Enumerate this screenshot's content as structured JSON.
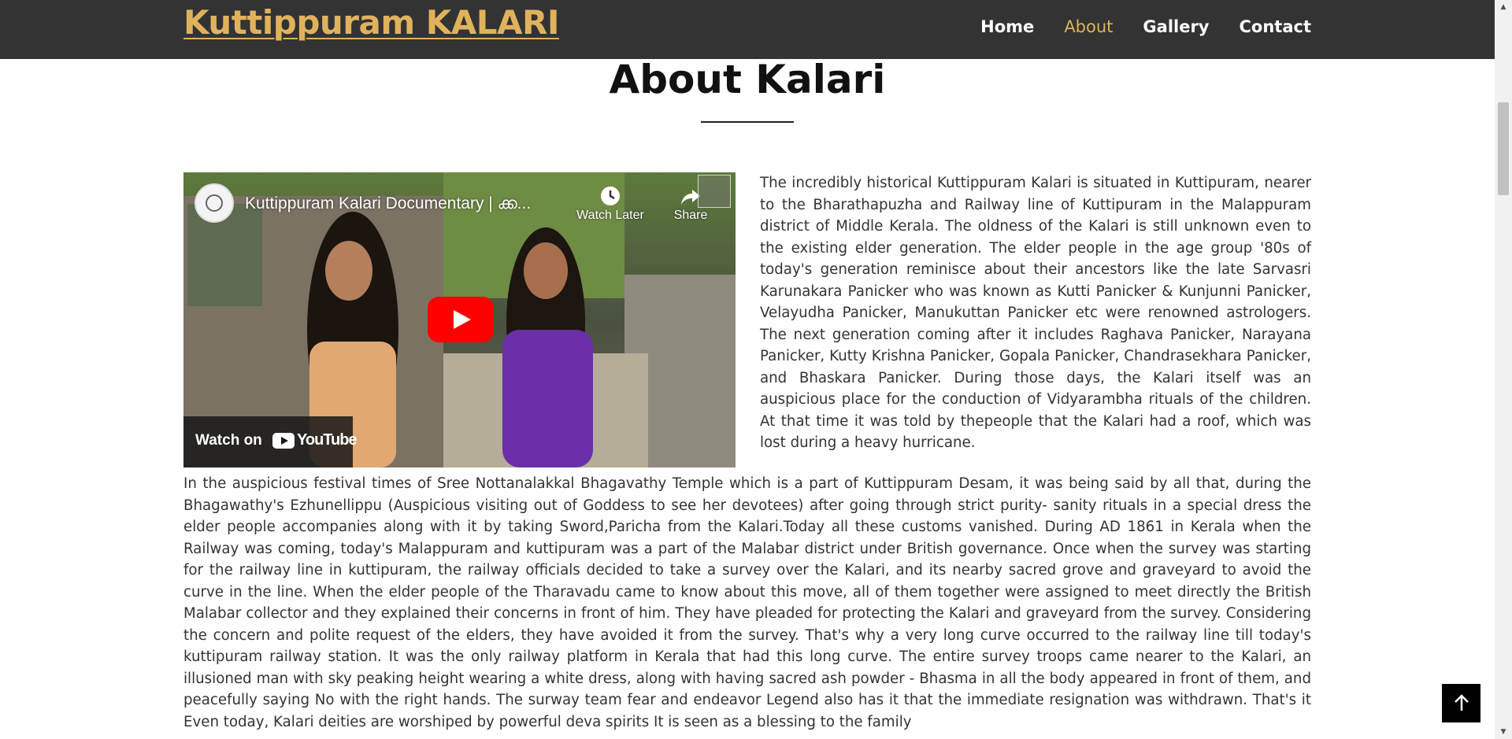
{
  "header": {
    "brand": "Kuttippuram KALARI",
    "nav": [
      {
        "label": "Home",
        "active": false
      },
      {
        "label": "About",
        "active": true
      },
      {
        "label": "Gallery",
        "active": false
      },
      {
        "label": "Contact",
        "active": false
      }
    ]
  },
  "main": {
    "title": "About Kalari",
    "video": {
      "title": "Kuttippuram Kalari Documentary | ക്ക...",
      "watch_later": "Watch Later",
      "share": "Share",
      "watch_on": "Watch on",
      "youtube": "YouTube"
    },
    "paragraph_1": "The incredibly historical Kuttippuram Kalari is situated in Kuttipuram, nearer to the Bharathapuzha and Railway line of Kuttipuram in the Malappuram district of Middle Kerala. The oldness of the Kalari is still unknown even to the existing elder generation. The elder people in the age group '80s of today's generation reminisce about their ancestors like the late Sarvasri Karunakara Panicker who was known as Kutti Panicker & Kunjunni Panicker, Velayudha Panicker, Manukuttan Panicker etc were renowned astrologers. The next generation coming after it includes Raghava Panicker, Narayana Panicker, Kutty Krishna Panicker, Gopala Panicker, Chandrasekhara Panicker, and Bhaskara Panicker. During those days, the Kalari itself was an auspicious place for the conduction of Vidyarambha rituals of the children. At that time it was told by thepeople that the Kalari had a roof, which was lost during a heavy hurricane.",
    "paragraph_2": "In the auspicious festival times of Sree Nottanalakkal Bhagavathy Temple which is a part of Kuttippuram Desam, it was being said by all that, during the Bhagawathy's Ezhunellippu (Auspicious visiting out of Goddess to see her devotees) after going through strict purity- sanity rituals in a special dress the elder people accompanies along with it by taking Sword,Paricha from the Kalari.Today all these customs vanished. During AD 1861 in Kerala when the Railway was coming, today's Malappuram and kuttipuram was a part of the Malabar district under British governance. Once when the survey was starting for the railway line in kuttipuram, the railway officials decided to take a survey over the Kalari, and its nearby sacred grove and graveyard to avoid the curve in the line. When the elder people of the Tharavadu came to know about this move, all of them together were assigned to meet directly the British Malabar collector and they explained their concerns in front of him. They have pleaded for protecting the Kalari and graveyard from the survey. Considering the concern and polite request of the elders, they have avoided it from the survey. That's why a very long curve occurred to the railway line till today's kuttipuram railway station. It was the only railway platform in Kerala that had this long curve. The entire survey troops came nearer to the Kalari, an illusioned man with sky peaking height wearing a white dress, along with having sacred ash powder - Bhasma in all the body appeared in front of them, and peacefully saying No with the right hands. The surway team fear and endeavor Legend also has it that the immediate resignation was withdrawn. That's it Even today, Kalari deities are worshiped by powerful deva spirits It is seen as a blessing to the family"
  },
  "colors": {
    "navbar_bg": "#333333",
    "brand": "#e0b25c",
    "nav_active": "#e0b25c",
    "youtube_red": "#ff0000"
  },
  "icons": [
    "clock-icon",
    "share-icon",
    "play-icon",
    "youtube-logo-icon",
    "arrow-up-icon"
  ]
}
